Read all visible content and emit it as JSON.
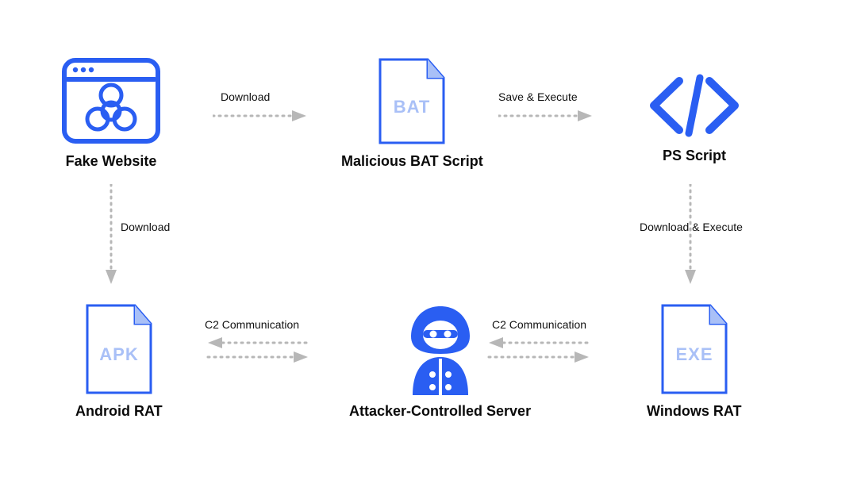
{
  "nodes": {
    "fake_website": {
      "label": "Fake Website"
    },
    "bat_script": {
      "label": "Malicious BAT Script",
      "file_text": "BAT"
    },
    "ps_script": {
      "label": "PS Script"
    },
    "android_rat": {
      "label": "Android RAT",
      "file_text": "APK"
    },
    "c2_server": {
      "label": "Attacker-Controlled Server"
    },
    "windows_rat": {
      "label": "Windows RAT",
      "file_text": "EXE"
    }
  },
  "edges": {
    "fw_to_bat": {
      "label": "Download"
    },
    "bat_to_ps": {
      "label": "Save & Execute"
    },
    "fw_to_apk": {
      "label": "Download"
    },
    "ps_to_exe": {
      "label": "Download & Execute"
    },
    "apk_c2": {
      "label": "C2 Communication"
    },
    "exe_c2": {
      "label": "C2 Communication"
    }
  }
}
